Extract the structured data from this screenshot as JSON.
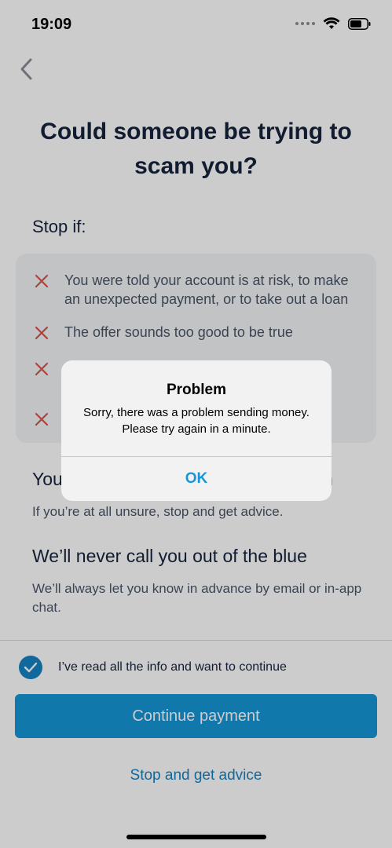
{
  "status_bar": {
    "time": "19:09"
  },
  "page": {
    "title_line1": "Could someone be trying to",
    "title_line2": "scam you?",
    "stop_heading": "Stop if:",
    "warnings": [
      "You were told your account is at risk, to make an unexpected payment, or to take out a loan",
      "The offer sounds too good to be true"
    ],
    "section1": {
      "heading_visible_start": "You",
      "heading_visible_end": "n",
      "text": "If you’re at all unsure, stop and get advice."
    },
    "section2": {
      "heading": "We’ll never call you out of the blue",
      "text": "We’ll always let you know in advance by email or in-app chat."
    }
  },
  "consent": {
    "label": "I’ve read all the info and want to continue",
    "checked": true
  },
  "buttons": {
    "continue_label": "Continue payment",
    "advice_label": "Stop and get advice"
  },
  "alert": {
    "title": "Problem",
    "message": "Sorry, there was a problem sending money. Please try again in a minute.",
    "ok_label": "OK"
  },
  "colors": {
    "accent": "#1696d8",
    "link": "#1682c2",
    "warning_x": "#d9534f",
    "heading": "#17233c"
  },
  "icons": {
    "back": "chevron-left-icon",
    "warning": "cross-icon",
    "check": "checkmark-icon"
  }
}
